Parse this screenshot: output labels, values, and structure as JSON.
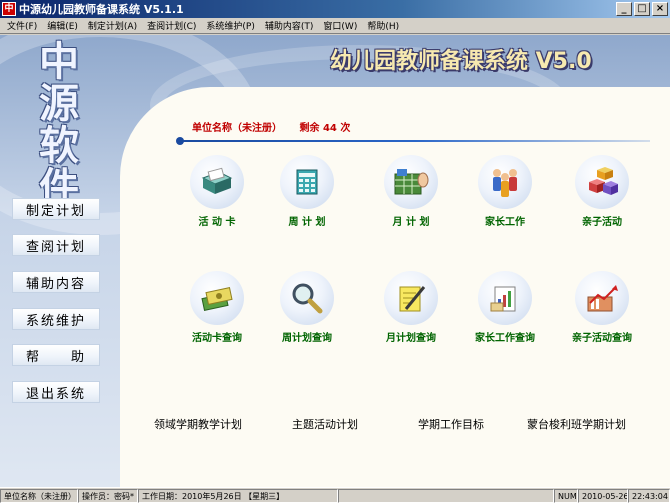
{
  "window": {
    "title": "中源幼儿园教师备课系统 V5.1.1",
    "icon_glyph": "中",
    "minimize": "_",
    "maximize": "□",
    "close": "×"
  },
  "menu": [
    "文件(F)",
    "编辑(E)",
    "制定计划(A)",
    "查阅计划(C)",
    "系统维护(P)",
    "辅助内容(T)",
    "窗口(W)",
    "帮助(H)"
  ],
  "brand": {
    "logo_text": "中源软件",
    "product_title": "幼儿园教师备课系统 V5.0"
  },
  "nav": [
    "制定计划",
    "查阅计划",
    "辅助内容",
    "系统维护",
    "帮　　助",
    "退出系统"
  ],
  "info": {
    "unit": "单位名称（未注册）",
    "remaining": "剩余 44 次"
  },
  "features_row1": [
    {
      "label": "活 动 卡",
      "icon": "card-box-icon"
    },
    {
      "label": "周 计 划",
      "icon": "calendar-grid-icon"
    },
    {
      "label": "月 计 划",
      "icon": "spreadsheet-hand-icon"
    },
    {
      "label": "家长工作",
      "icon": "people-group-icon"
    },
    {
      "label": "亲子活动",
      "icon": "cubes-icon"
    }
  ],
  "features_row2": [
    {
      "label": "活动卡查询",
      "icon": "money-stack-icon"
    },
    {
      "label": "周计划查询",
      "icon": "magnifier-icon"
    },
    {
      "label": "月计划查询",
      "icon": "pencil-note-icon"
    },
    {
      "label": "家长工作查询",
      "icon": "chart-document-icon"
    },
    {
      "label": "亲子活动查询",
      "icon": "trend-chart-icon"
    }
  ],
  "plans": [
    "领域学期教学计划",
    "主题活动计划",
    "学期工作目标",
    "蒙台梭利班学期计划"
  ],
  "status": {
    "unit": "单位名称（未注册）",
    "operator": "操作员：密码*",
    "date": "工作日期：2010年5月26日 【星期三】",
    "num": "NUM",
    "date_short": "2010-05-26",
    "time": "22:43:04"
  },
  "colors": {
    "title_bar": "#0a246a",
    "feature_label": "#006400",
    "info_text": "#c00000",
    "divider": "#1a4aa0"
  }
}
